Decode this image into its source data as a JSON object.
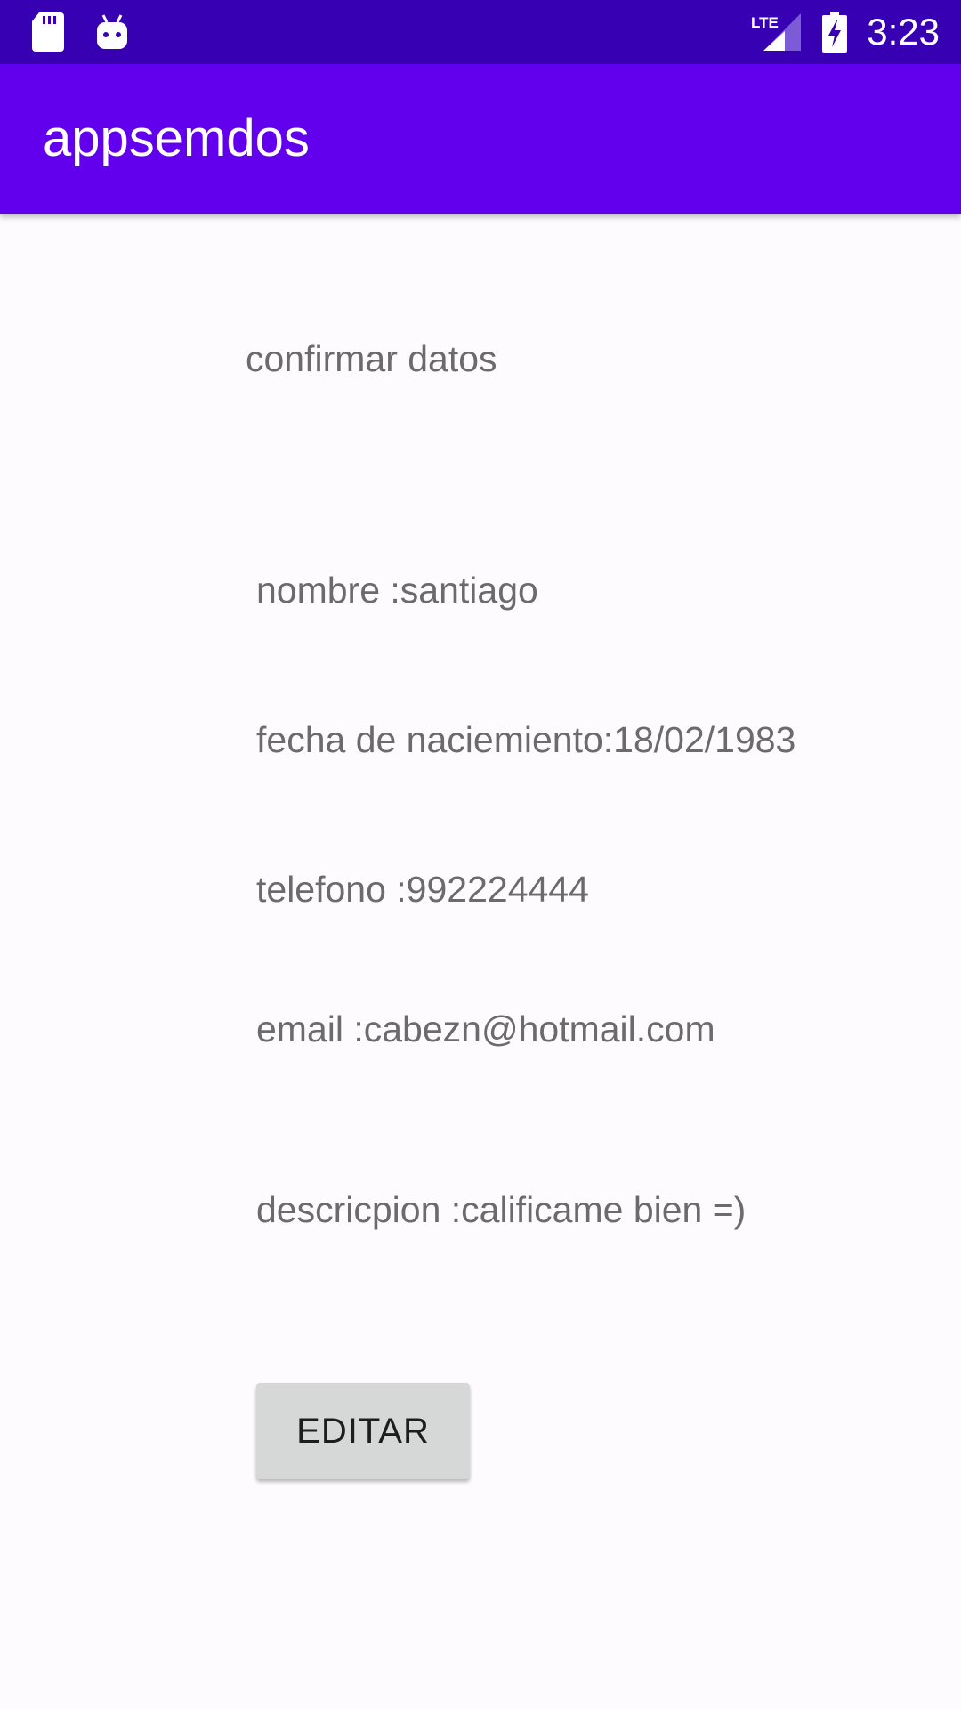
{
  "status_bar": {
    "time": "3:23",
    "network_label": "LTE",
    "background_color": "#3700b3",
    "left_icons": [
      "sd-card-icon",
      "android-debug-icon"
    ],
    "right_icons": [
      "lte-signal-icon",
      "battery-charging-icon"
    ]
  },
  "app_bar": {
    "title": "appsemdos",
    "background_color": "#6200ee"
  },
  "content": {
    "heading": "confirmar datos",
    "fields": {
      "nombre": "nombre :santiago",
      "fecha": "fecha de naciemiento:18/02/1983",
      "telefono": "telefono :992224444",
      "email": "email :cabezn@hotmail.com",
      "descripcion": "descricpion :calificame bien =)"
    },
    "edit_button_label": "EDITAR"
  }
}
